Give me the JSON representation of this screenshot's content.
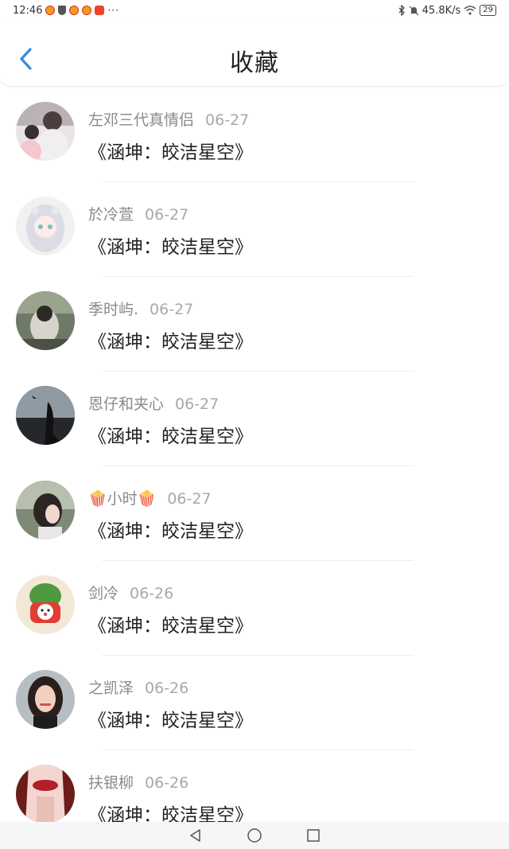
{
  "status_bar": {
    "time": "12:46",
    "network_speed": "45.8K/s",
    "battery": "29",
    "more": "···"
  },
  "header": {
    "title": "收藏",
    "back_icon": "chevron-left-icon"
  },
  "colors": {
    "accent": "#2f8ee0",
    "name_gray": "#8a8a8a",
    "date_gray": "#a8a8a8",
    "title_text": "#222222"
  },
  "items": [
    {
      "name": "左邓三代真情侣",
      "date": "06-27",
      "title": "《涵坤：皎洁星空》"
    },
    {
      "name": "於冷萱",
      "date": "06-27",
      "title": "《涵坤：皎洁星空》"
    },
    {
      "name": "季时屿.",
      "date": "06-27",
      "title": "《涵坤：皎洁星空》"
    },
    {
      "name": "恩仔和夹心",
      "date": "06-27",
      "title": "《涵坤：皎洁星空》"
    },
    {
      "name": "🍿小时🍿",
      "date": "06-27",
      "title": "《涵坤：皎洁星空》"
    },
    {
      "name": "剑冷",
      "date": "06-26",
      "title": "《涵坤：皎洁星空》"
    },
    {
      "name": "之凯泽",
      "date": "06-26",
      "title": "《涵坤：皎洁星空》"
    },
    {
      "name": "扶银柳",
      "date": "06-26",
      "title": "《涵坤：皎洁星空》"
    }
  ],
  "nav": {
    "back": "triangle-back-icon",
    "home": "circle-home-icon",
    "recent": "square-recent-icon"
  }
}
